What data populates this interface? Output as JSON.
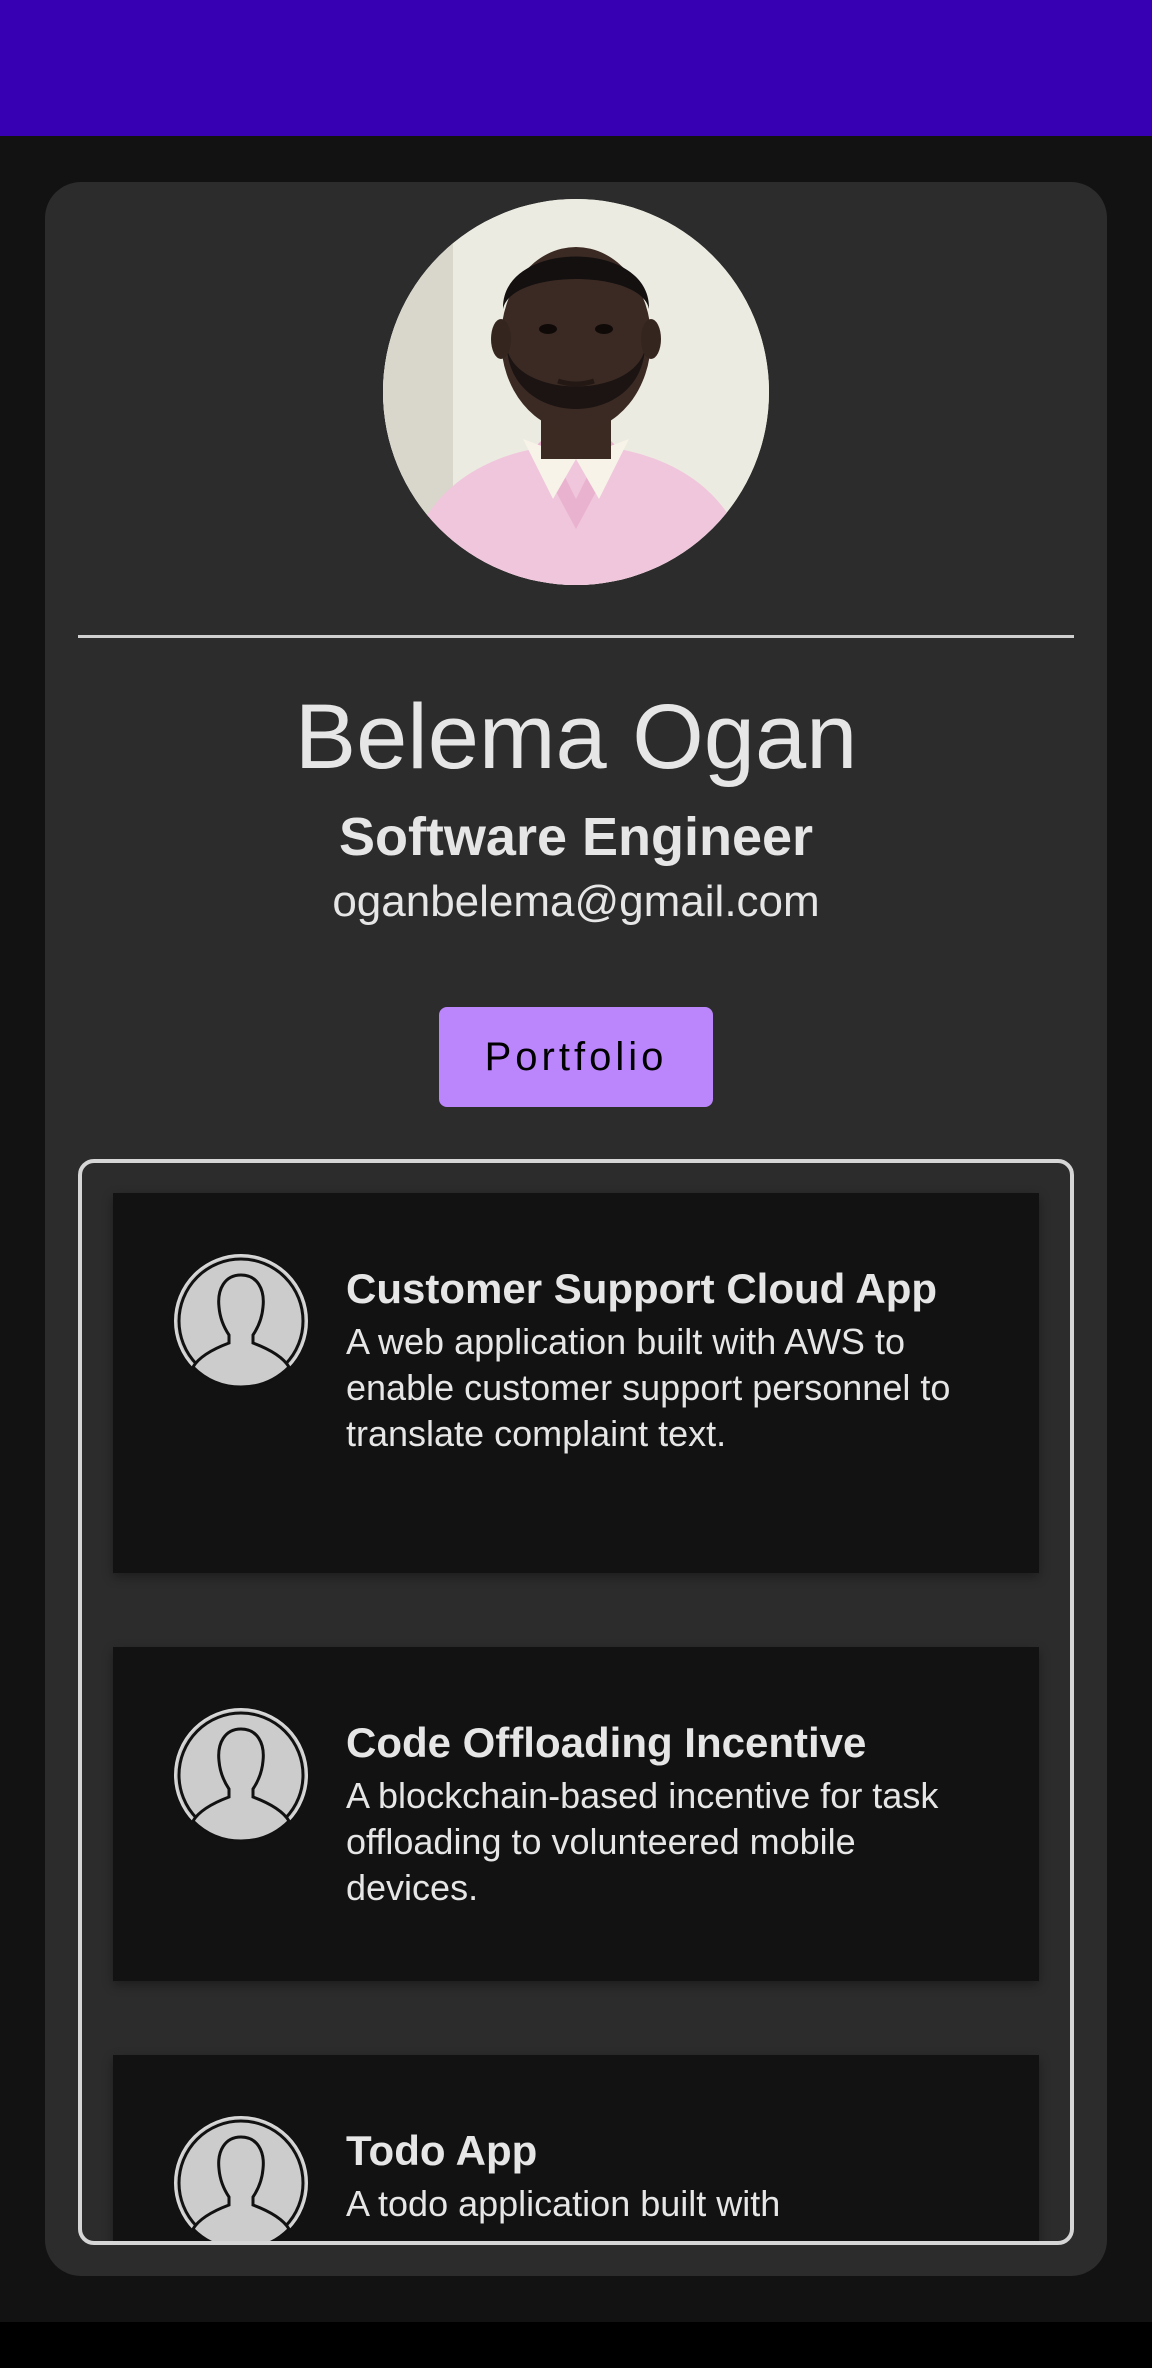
{
  "profile": {
    "name": "Belema Ogan",
    "role": "Software Engineer",
    "email": "oganbelema@gmail.com",
    "avatar_icon": "profile-photo"
  },
  "actions": {
    "portfolio_label": "Portfolio"
  },
  "projects": [
    {
      "title": "Customer Support Cloud App",
      "description": "A web application built with AWS to enable customer support personnel to translate complaint text.",
      "icon": "person-silhouette-icon"
    },
    {
      "title": "Code Offloading Incentive",
      "description": "A blockchain-based incentive for task offloading to volunteered mobile devices.",
      "icon": "person-silhouette-icon"
    },
    {
      "title": "Todo App",
      "description": "A todo application built with",
      "icon": "person-silhouette-icon"
    }
  ],
  "colors": {
    "status_bar": "#3700b3",
    "background": "#121212",
    "card": "#2c2c2c",
    "accent": "#bb86fc",
    "text": "#e6e6e6"
  }
}
